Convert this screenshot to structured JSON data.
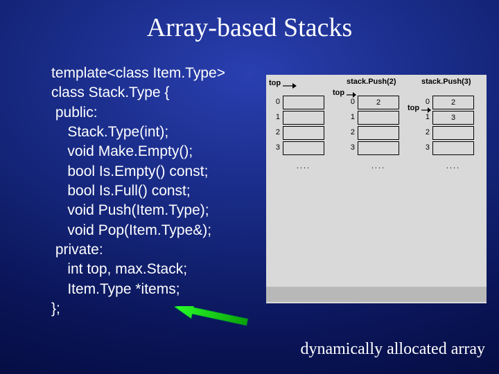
{
  "title": "Array-based Stacks",
  "code": {
    "l0": "template<class Item.Type>",
    "l1": "class Stack.Type {",
    "l2": " public:",
    "l3": "    Stack.Type(int);",
    "l4": "    void Make.Empty();",
    "l5": "    bool Is.Empty() const;",
    "l6": "    bool Is.Full() const;",
    "l7": "    void Push(Item.Type);",
    "l8": "    void Pop(Item.Type&);",
    "l9": " private:",
    "l10": "    int top, max.Stack;",
    "l11": "    Item.Type *items;",
    "l12": "};"
  },
  "diagram": {
    "states": [
      {
        "label": "",
        "top_text": "top",
        "top_points_before": true,
        "cells": [
          "",
          "",
          "",
          ""
        ],
        "indices": [
          "0",
          "1",
          "2",
          "3"
        ]
      },
      {
        "label": "stack.Push(2)",
        "top_text": "top",
        "top_row": 0,
        "cells": [
          "2",
          "",
          "",
          ""
        ],
        "indices": [
          "0",
          "1",
          "2",
          "3"
        ]
      },
      {
        "label": "stack.Push(3)",
        "top_text": "top",
        "top_row": 1,
        "cells": [
          "2",
          "3",
          "",
          ""
        ],
        "indices": [
          "0",
          "1",
          "2",
          "3"
        ]
      }
    ],
    "dots": "....",
    "caption": "dynamically allocated array"
  }
}
